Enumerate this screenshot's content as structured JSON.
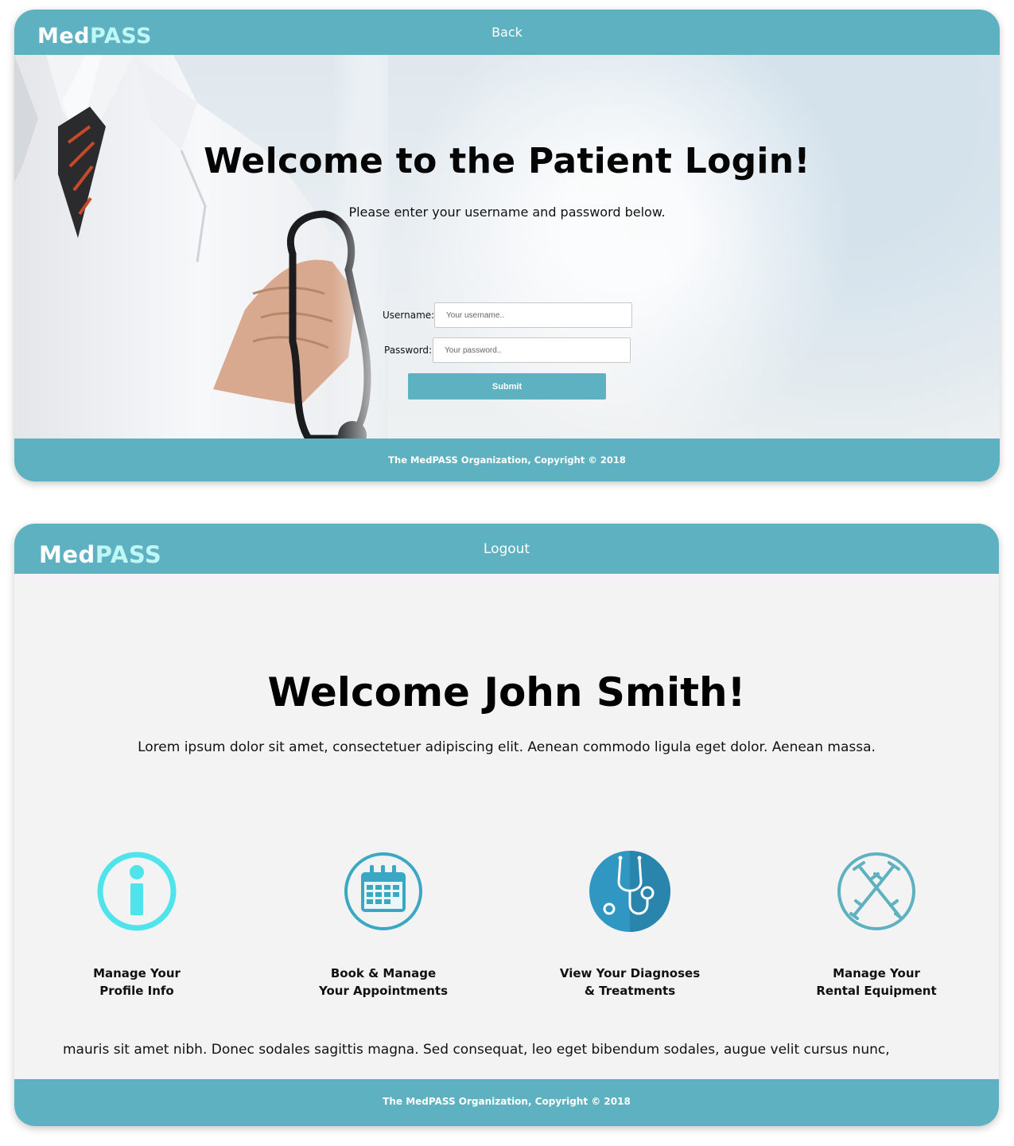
{
  "brand": {
    "name_part1": "Med",
    "name_part2": "PASS"
  },
  "login_page": {
    "nav_link": "Back",
    "title": "Welcome to the Patient Login!",
    "subtitle": "Please enter your username and password below.",
    "username_label": "Username:",
    "username_placeholder": "Your username..",
    "password_label": "Password:",
    "password_placeholder": "Your password..",
    "submit_label": "Submit",
    "footer": "The MedPASS Organization, Copyright © 2018"
  },
  "dashboard_page": {
    "nav_link": "Logout",
    "title": "Welcome John Smith!",
    "intro": "Lorem ipsum dolor sit amet, consectetuer adipiscing elit. Aenean commodo ligula eget dolor. Aenean massa.",
    "tiles": [
      {
        "icon": "info-icon",
        "label": "Manage Your\nProfile Info"
      },
      {
        "icon": "calendar-icon",
        "label": "Book & Manage\nYour Appointments"
      },
      {
        "icon": "stethoscope-icon",
        "label": "View Your Diagnoses\n& Treatments"
      },
      {
        "icon": "crutches-icon",
        "label": "Manage Your\nRental Equipment"
      }
    ],
    "body_text": "mauris sit amet nibh. Donec sodales sagittis magna. Sed consequat, leo eget bibendum sodales, augue velit cursus nunc,",
    "footer": "The MedPASS Organization, Copyright © 2018"
  },
  "colors": {
    "accent": "#5eb1c0",
    "logo_accent": "#bff6f6",
    "info_icon": "#4fe3ec",
    "calendar_icon": "#3aa8c4",
    "stethoscope_icon": "#2f97c2",
    "crutches_icon": "#5eb1c0"
  }
}
